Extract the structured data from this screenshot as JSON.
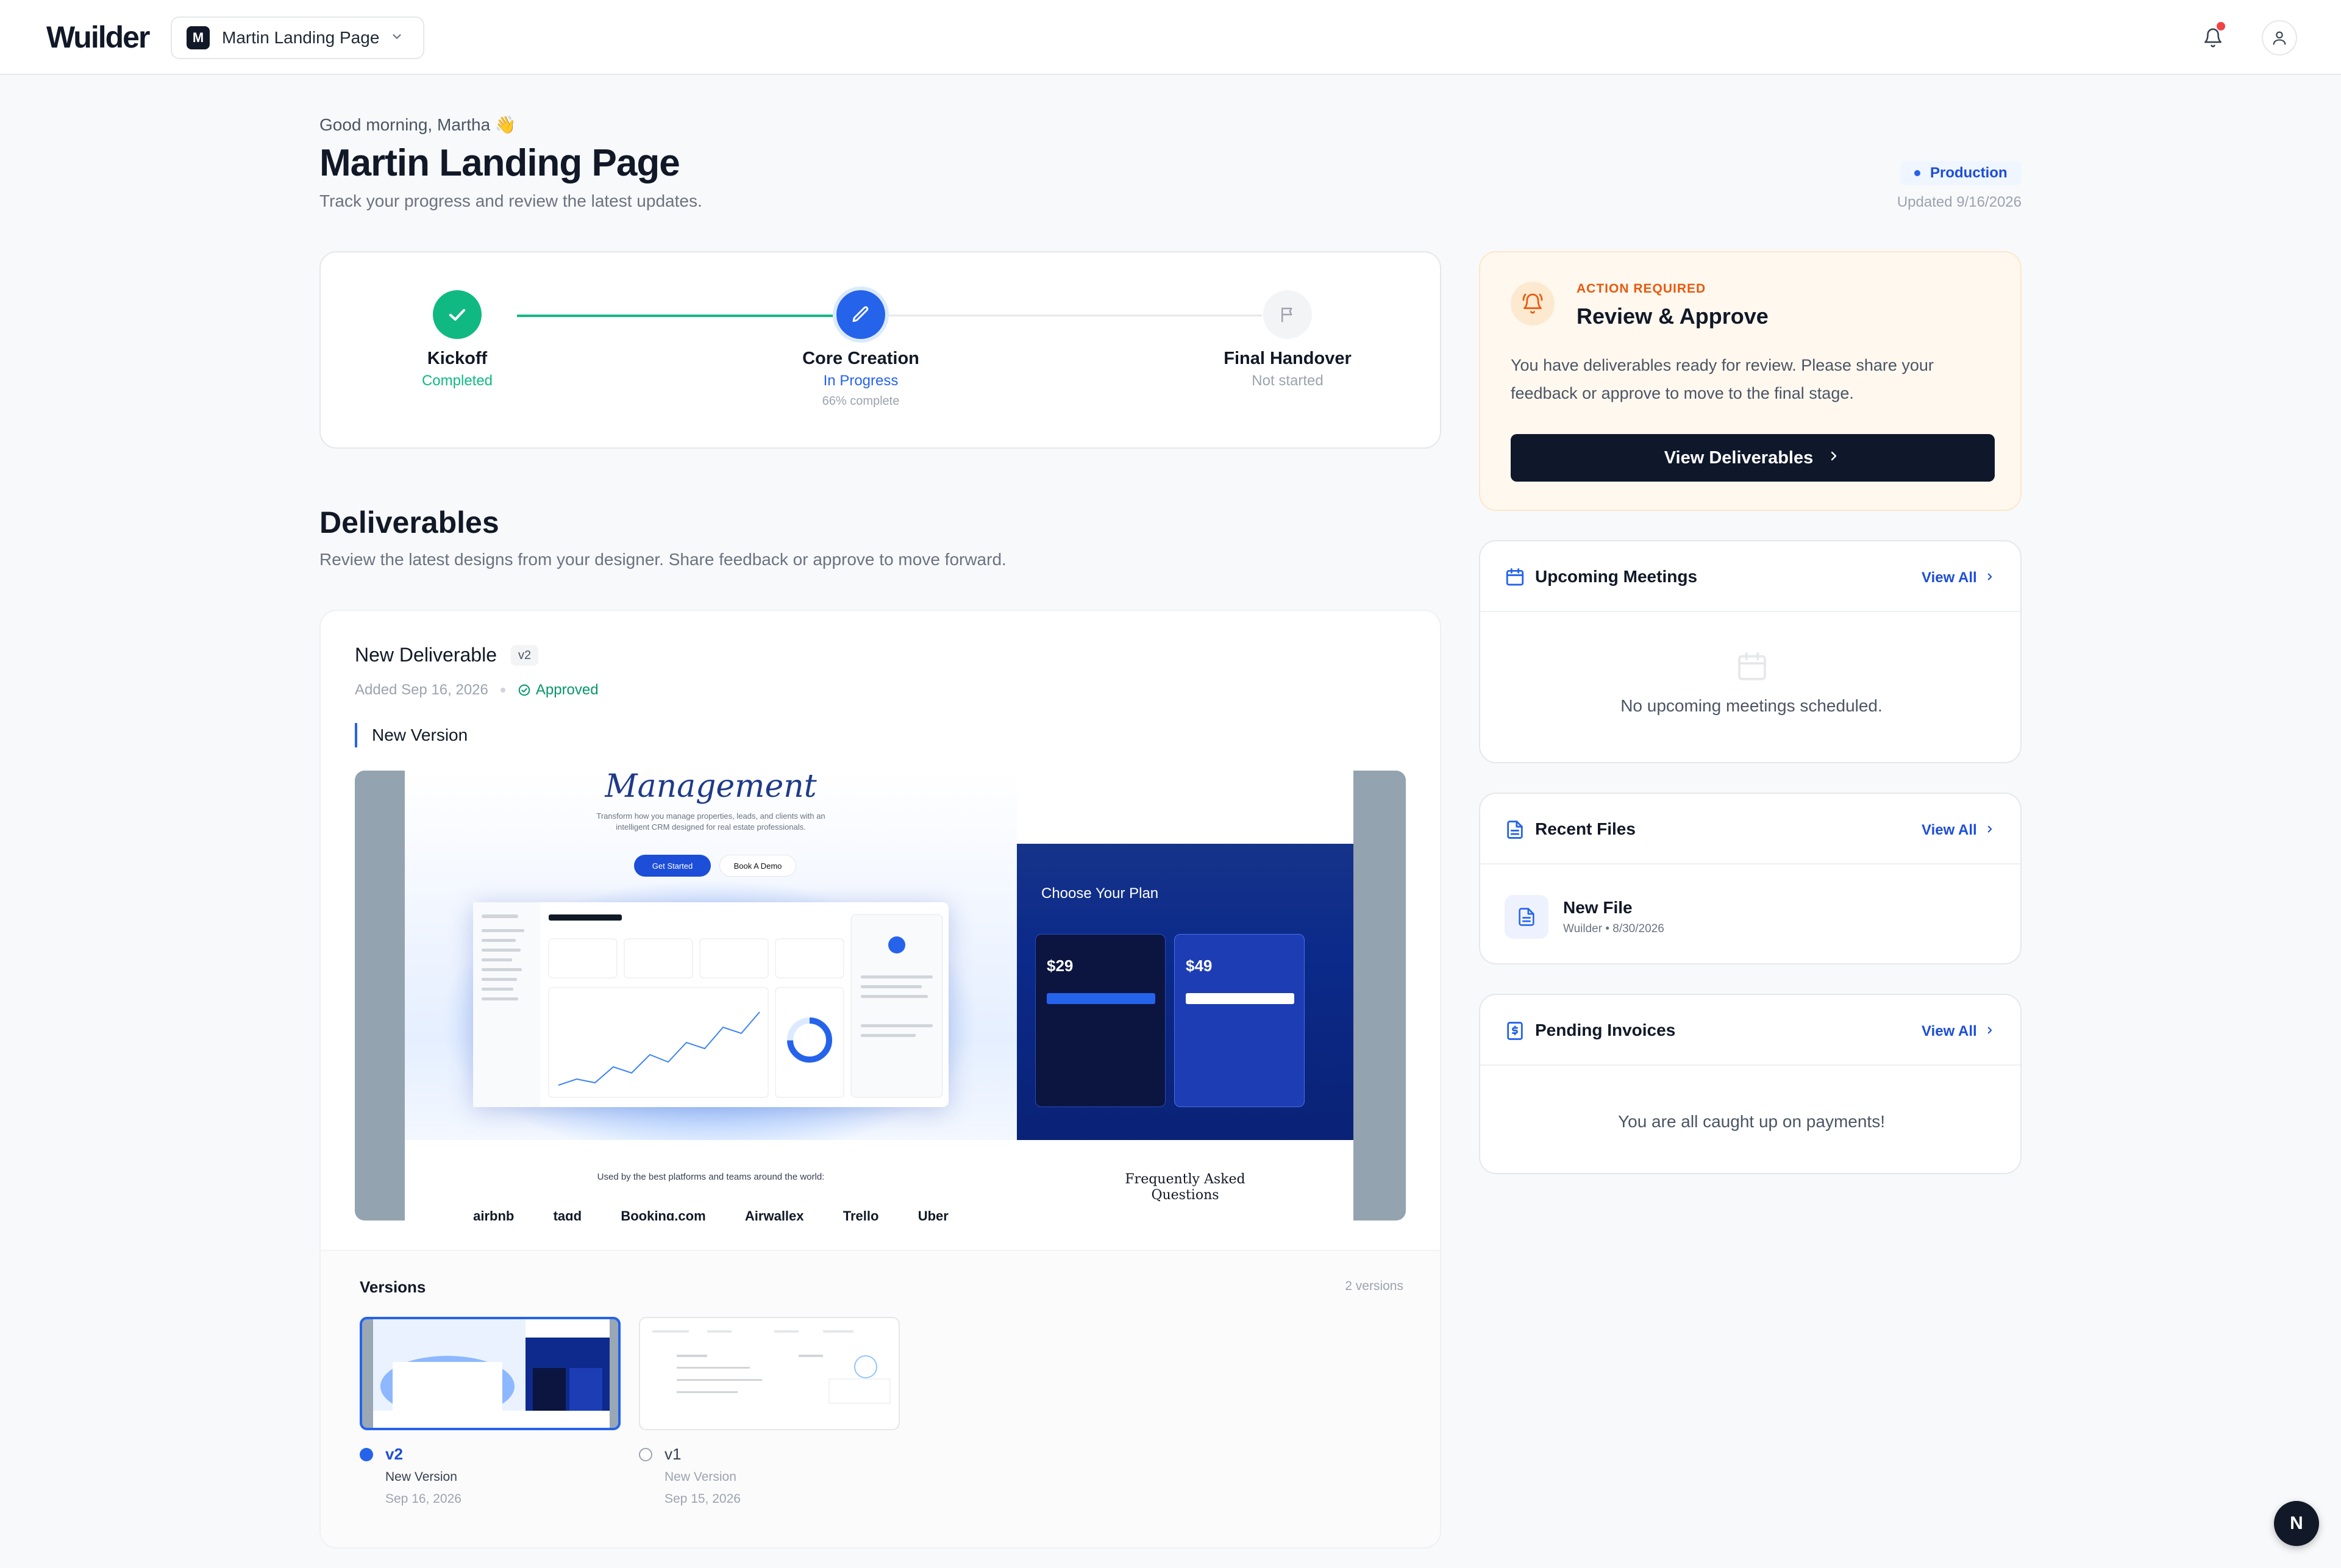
{
  "app": {
    "logo": "Wuilder"
  },
  "header": {
    "project_initial": "M",
    "project_name": "Martin Landing Page"
  },
  "page": {
    "greeting": "Good morning, Martha 👋",
    "title": "Martin Landing Page",
    "subtitle": "Track your progress and review the latest updates.",
    "env_badge": "Production",
    "updated": "Updated 9/16/2026"
  },
  "progress": {
    "steps": [
      {
        "label": "Kickoff",
        "status": "Completed"
      },
      {
        "label": "Core Creation",
        "status": "In Progress",
        "pct_text": "66% complete"
      },
      {
        "label": "Final Handover",
        "status": "Not started"
      }
    ]
  },
  "deliverables": {
    "title": "Deliverables",
    "subtitle": "Review the latest designs from your designer. Share feedback or approve to move forward.",
    "item": {
      "name": "New Deliverable",
      "version_chip": "v2",
      "added": "Added Sep 16, 2026",
      "status": "Approved",
      "version_label": "New Version"
    },
    "preview": {
      "hero_heading": "Management",
      "hero_text": "Transform how you manage properties, leads, and clients with an intelligent CRM designed for real estate professionals.",
      "btn_primary": "Get Started",
      "btn_secondary": "Book A Demo",
      "used_by": "Used by the best platforms and teams around the world:",
      "logos": [
        "airbnb",
        "tagd",
        "Booking.com",
        "Airwallex",
        "Trello",
        "Uber"
      ],
      "plan_heading": "Choose Your Plan",
      "plan_prices": [
        "$29",
        "$49"
      ],
      "faq_heading": "Frequently Asked Questions"
    },
    "versions": {
      "title": "Versions",
      "count": "2 versions",
      "list": [
        {
          "tag": "v2",
          "label": "New Version",
          "date": "Sep 16, 2026"
        },
        {
          "tag": "v1",
          "label": "New Version",
          "date": "Sep 15, 2026"
        }
      ]
    }
  },
  "action": {
    "kicker": "ACTION REQUIRED",
    "title": "Review & Approve",
    "body": "You have deliverables ready for review. Please share your feedback or approve to move to the final stage.",
    "button": "View Deliverables"
  },
  "meetings": {
    "title": "Upcoming Meetings",
    "view_all": "View All",
    "empty": "No upcoming meetings scheduled."
  },
  "files": {
    "title": "Recent Files",
    "view_all": "View All",
    "items": [
      {
        "name": "New File",
        "meta": "Wuilder • 8/30/2026"
      }
    ]
  },
  "invoices": {
    "title": "Pending Invoices",
    "view_all": "View All",
    "empty": "You are all caught up on payments!"
  },
  "fab": {
    "label": "N"
  },
  "colors": {
    "accent": "#1d4ed8",
    "success": "#10b981",
    "warning": "#ea580c",
    "dark": "#0f172a"
  }
}
